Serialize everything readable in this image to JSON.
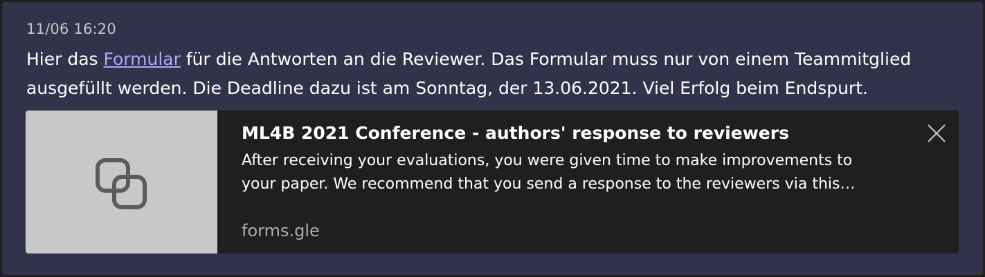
{
  "message": {
    "timestamp": "11/06 16:20",
    "text_before_link": "Hier das ",
    "link_text": "Formular",
    "text_after_link": " für die Antworten an die Reviewer. Das Formular muss nur von einem Teammitglied ausgefüllt werden. Die Deadline dazu ist am Sonntag, der 13.06.2021. Viel Erfolg beim Endspurt."
  },
  "preview": {
    "title": "ML4B 2021 Conference - authors' response to reviewers",
    "description": "After receiving your evaluations, you were given time to make improvements to your paper. We recommend that you send a response to the reviewers via this…",
    "domain": "forms.gle",
    "thumbnail_icon": "link-icon",
    "close_icon": "close-icon"
  },
  "colors": {
    "message_background": "#32324a",
    "card_background": "#1f1f1f",
    "thumbnail_background": "#c8c8c8",
    "link": "#aaaaff"
  }
}
